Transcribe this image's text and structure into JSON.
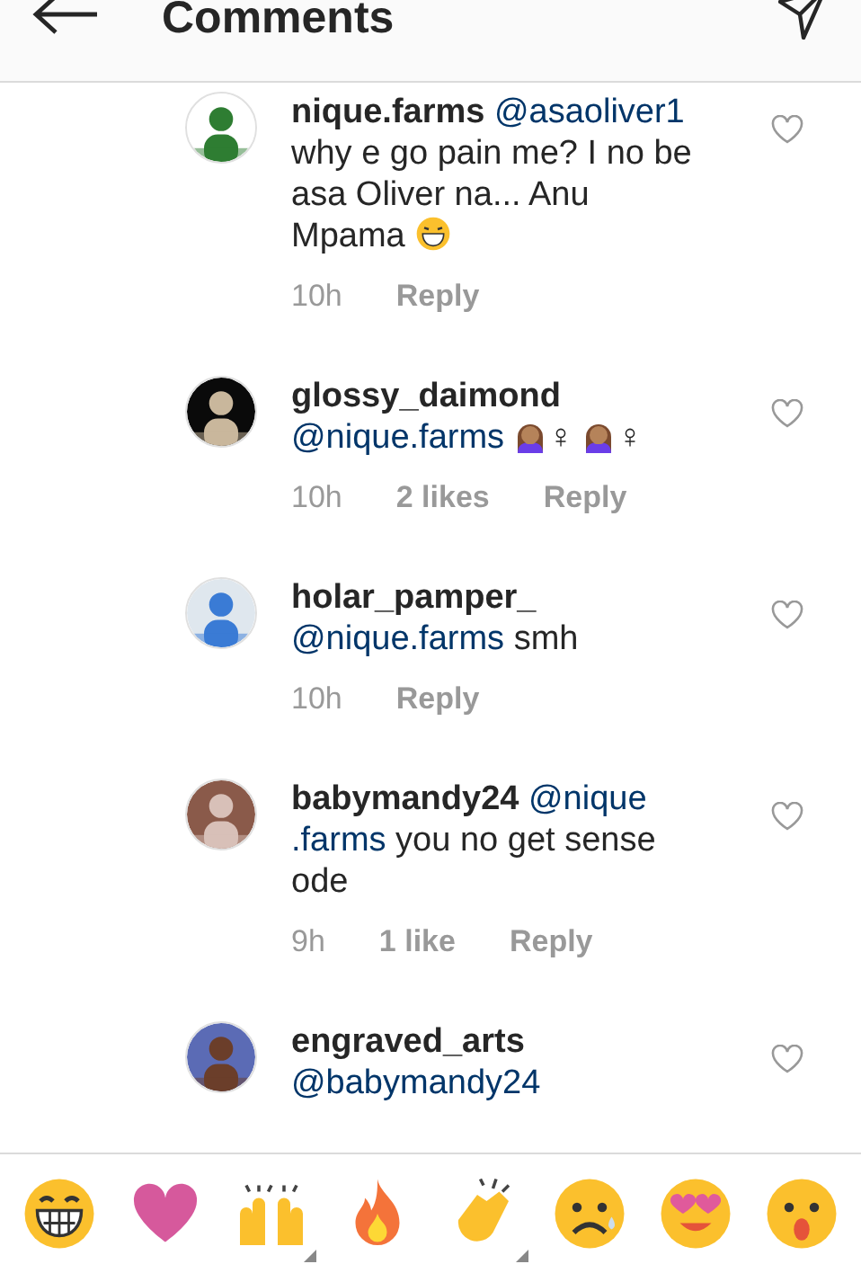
{
  "header": {
    "title": "Comments"
  },
  "comments": [
    {
      "user": "nique.farms",
      "segments": [
        {
          "kind": "mention",
          "text": "@asaoliver1"
        },
        {
          "kind": "text",
          "text": "why e go pain me? I no be asa Oliver na... Anu Mpama"
        },
        {
          "kind": "laugh"
        }
      ],
      "time": "10h",
      "reply": "Reply"
    },
    {
      "user": "glossy_daimond",
      "segments": [
        {
          "kind": "mention",
          "text": "@nique.farms"
        },
        {
          "kind": "facepalm"
        },
        {
          "kind": "text",
          "text": "♀"
        },
        {
          "kind": "facepalm"
        },
        {
          "kind": "text",
          "text": "♀"
        }
      ],
      "time": "10h",
      "likes": "2 likes",
      "reply": "Reply"
    },
    {
      "user": "holar_pamper_",
      "segments": [
        {
          "kind": "mention",
          "text": "@nique.farms"
        },
        {
          "kind": "text",
          "text": "smh"
        }
      ],
      "time": "10h",
      "reply": "Reply"
    },
    {
      "user": "babymandy24",
      "segments": [
        {
          "kind": "mention",
          "text": "@nique .farms"
        },
        {
          "kind": "text",
          "text": "you no get sense ode"
        }
      ],
      "time": "9h",
      "likes": "1 like",
      "reply": "Reply"
    },
    {
      "user": "engraved_arts",
      "segments": [
        {
          "kind": "mention",
          "text": "@babymandy24"
        }
      ]
    }
  ],
  "emoji_bar": [
    {
      "kind": "grin",
      "has_variants": false
    },
    {
      "kind": "heart",
      "has_variants": false
    },
    {
      "kind": "raised-hands",
      "has_variants": true
    },
    {
      "kind": "fire",
      "has_variants": false
    },
    {
      "kind": "clap",
      "has_variants": true
    },
    {
      "kind": "sad",
      "has_variants": false
    },
    {
      "kind": "heart-eyes",
      "has_variants": false
    },
    {
      "kind": "open-mouth",
      "has_variants": false
    }
  ]
}
